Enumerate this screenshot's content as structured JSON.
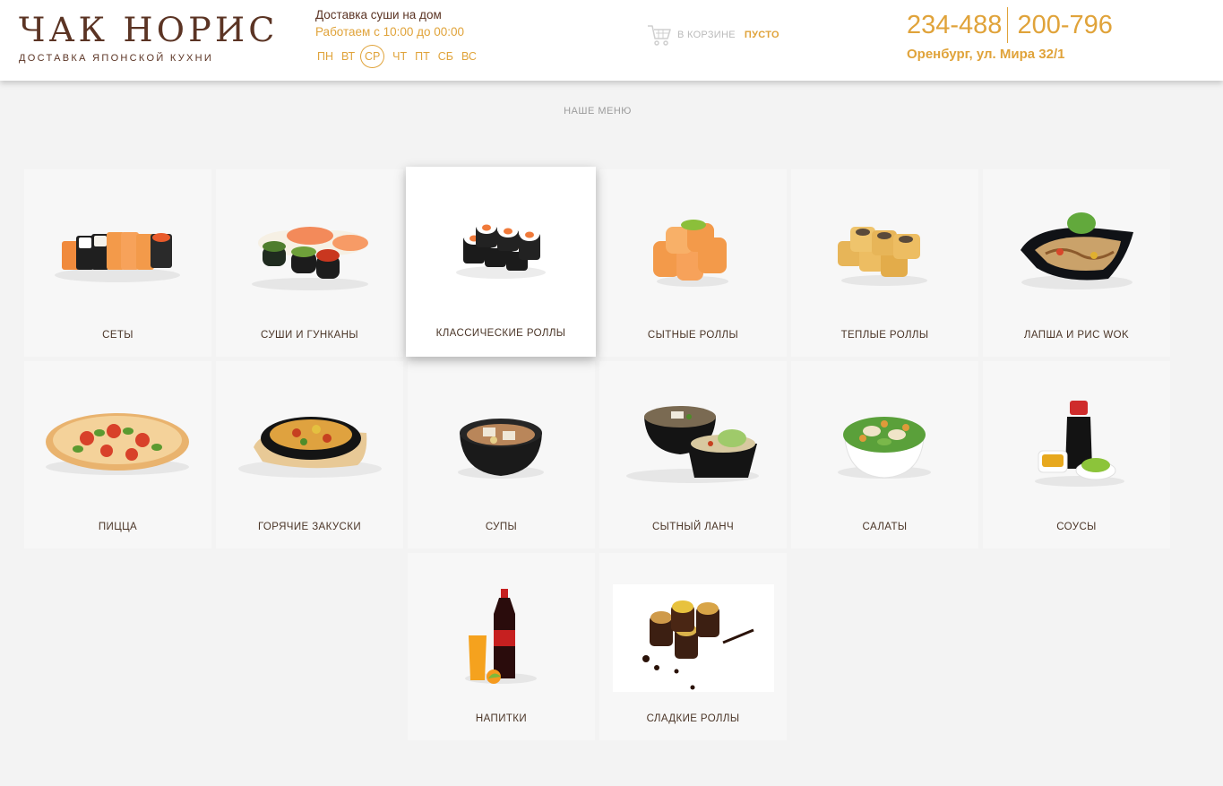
{
  "brand": {
    "title": "ЧАК НОРИС",
    "subtitle": "ДОСТАВКА ЯПОНСКОЙ КУХНИ"
  },
  "delivery": {
    "title": "Доставка суши на дом",
    "hours": "Работаем с 10:00 до 00:00",
    "days": [
      "ПН",
      "ВТ",
      "СР",
      "ЧТ",
      "ПТ",
      "СБ",
      "ВС"
    ],
    "active_day": "СР"
  },
  "cart": {
    "icon": "cart-icon",
    "label": "В КОРЗИНЕ",
    "status": "ПУСТО"
  },
  "contacts": {
    "phone1": "234-488",
    "phone2": "200-796",
    "address": "Оренбург, ул. Мира 32/1"
  },
  "menu": {
    "title": "НАШЕ МЕНЮ",
    "items": [
      {
        "label": "СЕТЫ"
      },
      {
        "label": "СУШИ И ГУНКАНЫ"
      },
      {
        "label": "КЛАССИЧЕСКИЕ РОЛЛЫ"
      },
      {
        "label": "СЫТНЫЕ РОЛЛЫ"
      },
      {
        "label": "ТЕПЛЫЕ РОЛЛЫ"
      },
      {
        "label": "ЛАПША И РИС WOK"
      },
      {
        "label": "ПИЦЦА"
      },
      {
        "label": "ГОРЯЧИЕ ЗАКУСКИ"
      },
      {
        "label": "СУПЫ"
      },
      {
        "label": "СЫТНЫЙ ЛАНЧ"
      },
      {
        "label": "САЛАТЫ"
      },
      {
        "label": "СОУСЫ"
      },
      {
        "label": "НАПИТКИ"
      },
      {
        "label": "СЛАДКИЕ РОЛЛЫ"
      }
    ]
  },
  "colors": {
    "brand_brown": "#5b3424",
    "accent_gold": "#e0a33a",
    "background": "#f3f3f3"
  }
}
